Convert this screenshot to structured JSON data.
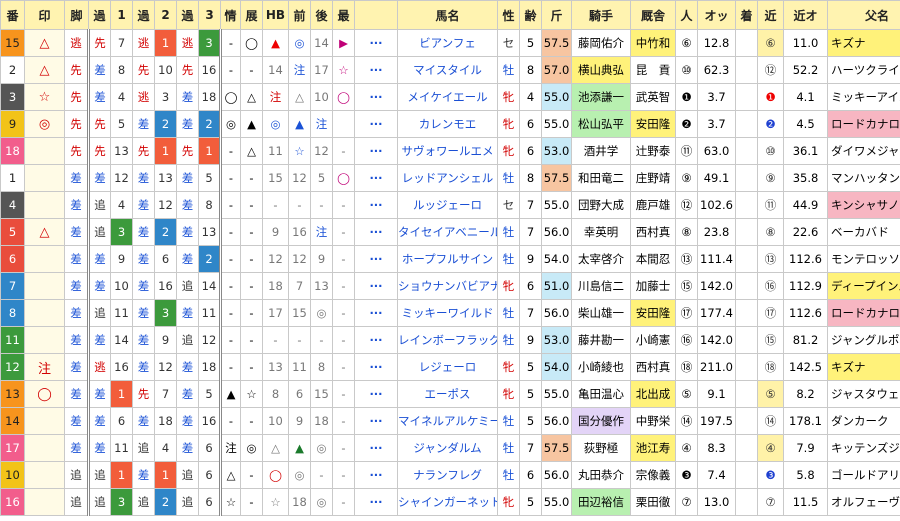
{
  "headers": [
    "番",
    "印",
    "脚",
    "過",
    "1",
    "過",
    "2",
    "過",
    "3",
    "情",
    "展",
    "HB",
    "前",
    "後",
    "最",
    "",
    "馬名",
    "性",
    "齢",
    "斤",
    "騎手",
    "厩舎",
    "人",
    "オッ",
    "着",
    "近",
    "近オ",
    "父名"
  ],
  "rows": [
    {
      "num": "15",
      "num_bg": "#f7941d",
      "mark": "△",
      "mark_c": "#d20000",
      "kyaku": "逃",
      "kyaku_c": "#d20000",
      "p1": "先",
      "p1c": "#d20000",
      "r1": "7",
      "r1bg": "",
      "p2": "逃",
      "p2c": "#d20000",
      "r2": "1",
      "r2bg": "#f25d3b",
      "p3": "逃",
      "p3c": "#d20000",
      "r3": "3",
      "r3bg": "#3c9a3c",
      "jo": "-",
      "ten": "◯",
      "hb": "▲",
      "hbc": "#e00",
      "mae": "◎",
      "maec": "#1b52d6",
      "ato": "14",
      "atoc": "#777",
      "sai": "▶",
      "saic": "#c00077",
      "name": "ビアンフェ",
      "sex": "セ",
      "sexc": "#333",
      "age": "5",
      "kin": "57.5",
      "kinbg": "#f7c5a1",
      "jockey": "藤岡佑介",
      "jbg": "",
      "trainer": "中竹和",
      "tbg": "#fff27a",
      "ninki": "⑥",
      "odds": "12.8",
      "chaku": "",
      "kin2": "⑥",
      "kin2bg": "#fff2a8",
      "kin2c": "#333",
      "kodds": "11.0",
      "sire": "キズナ",
      "sirebg": "#fff27a"
    },
    {
      "num": "2",
      "num_bg": "#ffffff",
      "mark": "△",
      "mark_c": "#d20000",
      "kyaku": "先",
      "kyaku_c": "#d20000",
      "p1": "差",
      "p1c": "#1b52d6",
      "r1": "8",
      "r1bg": "",
      "p2": "先",
      "p2c": "#d20000",
      "r2": "10",
      "r2bg": "",
      "p3": "先",
      "p3c": "#d20000",
      "r3": "16",
      "r3bg": "",
      "jo": "-",
      "ten": "-",
      "hb": "14",
      "hbc": "#777",
      "mae": "注",
      "maec": "#1b52d6",
      "ato": "17",
      "atoc": "#777",
      "sai": "☆",
      "saic": "#c00077",
      "name": "マイスタイル",
      "sex": "牡",
      "sexc": "#1b52d6",
      "age": "8",
      "kin": "57.0",
      "kinbg": "#f7c5a1",
      "jockey": "横山典弘",
      "jbg": "#fff27a",
      "trainer": "昆　貢",
      "tbg": "",
      "ninki": "⑩",
      "odds": "62.3",
      "chaku": "",
      "kin2": "⑫",
      "kin2bg": "",
      "kin2c": "#333",
      "kodds": "52.2",
      "sire": "ハーツクライ",
      "sirebg": ""
    },
    {
      "num": "3",
      "num_bg": "#555555",
      "mark": "☆",
      "mark_c": "#d20000",
      "kyaku": "先",
      "kyaku_c": "#d20000",
      "p1": "差",
      "p1c": "#1b52d6",
      "r1": "4",
      "r1bg": "",
      "p2": "逃",
      "p2c": "#d20000",
      "r2": "3",
      "r2bg": "",
      "p3": "差",
      "p3c": "#1b52d6",
      "r3": "18",
      "r3bg": "",
      "jo": "◯",
      "ten": "△",
      "hb": "注",
      "hbc": "#d20000",
      "mae": "△",
      "maec": "#777",
      "ato": "10",
      "atoc": "#777",
      "sai": "◯",
      "saic": "#c00077",
      "name": "メイケイエール",
      "sex": "牝",
      "sexc": "#d20000",
      "age": "4",
      "kin": "55.0",
      "kinbg": "#c8eaf7",
      "jockey": "池添謙一",
      "jbg": "#b8f0b0",
      "trainer": "武英智",
      "tbg": "",
      "ninki": "❶",
      "odds": "3.7",
      "chaku": "",
      "kin2": "❶",
      "kin2bg": "",
      "kin2c": "#e00",
      "kodds": "4.1",
      "sire": "ミッキーアイル",
      "sirebg": ""
    },
    {
      "num": "9",
      "num_bg": "#f2c318",
      "mark": "◎",
      "mark_c": "#d20000",
      "kyaku": "先",
      "kyaku_c": "#d20000",
      "p1": "先",
      "p1c": "#d20000",
      "r1": "5",
      "r1bg": "",
      "p2": "差",
      "p2c": "#1b52d6",
      "r2": "2",
      "r2bg": "#2f86c8",
      "p3": "差",
      "p3c": "#1b52d6",
      "r3": "2",
      "r3bg": "#2f86c8",
      "jo": "◎",
      "ten": "▲",
      "hb": "◎",
      "hbc": "#1b52d6",
      "mae": "▲",
      "maec": "#1b52d6",
      "ato": "注",
      "atoc": "#1b52d6",
      "sai": "",
      "saic": "#c00077",
      "name": "カレンモエ",
      "sex": "牝",
      "sexc": "#d20000",
      "age": "6",
      "kin": "55.0",
      "kinbg": "",
      "jockey": "松山弘平",
      "jbg": "#b8f0b0",
      "trainer": "安田隆",
      "tbg": "#fff27a",
      "ninki": "❷",
      "odds": "3.7",
      "chaku": "",
      "kin2": "❷",
      "kin2bg": "",
      "kin2c": "#1d3fd0",
      "kodds": "4.5",
      "sire": "ロードカナロア",
      "sirebg": "#f7b6c2"
    },
    {
      "num": "18",
      "num_bg": "#f25d8c",
      "mark": "",
      "mark_c": "#d20000",
      "kyaku": "先",
      "kyaku_c": "#d20000",
      "p1": "先",
      "p1c": "#d20000",
      "r1": "13",
      "r1bg": "",
      "p2": "先",
      "p2c": "#d20000",
      "r2": "1",
      "r2bg": "#f25d3b",
      "p3": "先",
      "p3c": "#d20000",
      "r3": "1",
      "r3bg": "#f25d3b",
      "jo": "-",
      "ten": "△",
      "hb": "11",
      "hbc": "#777",
      "mae": "☆",
      "maec": "#1b52d6",
      "ato": "12",
      "atoc": "#777",
      "sai": "-",
      "saic": "#777",
      "name": "サヴォワールエメ",
      "sex": "牝",
      "sexc": "#d20000",
      "age": "6",
      "kin": "53.0",
      "kinbg": "#c8eaf7",
      "jockey": "酒井学",
      "jbg": "",
      "trainer": "辻野泰",
      "tbg": "",
      "ninki": "⑪",
      "odds": "63.0",
      "chaku": "",
      "kin2": "⑩",
      "kin2bg": "",
      "kin2c": "#333",
      "kodds": "36.1",
      "sire": "ダイワメジャー",
      "sirebg": ""
    },
    {
      "num": "1",
      "num_bg": "#ffffff",
      "mark": "",
      "mark_c": "#d20000",
      "kyaku": "差",
      "kyaku_c": "#1b52d6",
      "p1": "差",
      "p1c": "#1b52d6",
      "r1": "12",
      "r1bg": "",
      "p2": "差",
      "p2c": "#1b52d6",
      "r2": "13",
      "r2bg": "",
      "p3": "差",
      "p3c": "#1b52d6",
      "r3": "5",
      "r3bg": "",
      "jo": "-",
      "ten": "-",
      "hb": "15",
      "hbc": "#777",
      "mae": "12",
      "maec": "#777",
      "ato": "5",
      "atoc": "#777",
      "sai": "◯",
      "saic": "#c00077",
      "name": "レッドアンシェル",
      "sex": "牡",
      "sexc": "#1b52d6",
      "age": "8",
      "kin": "57.5",
      "kinbg": "#f7c5a1",
      "jockey": "和田竜二",
      "jbg": "",
      "trainer": "庄野靖",
      "tbg": "",
      "ninki": "⑨",
      "odds": "49.1",
      "chaku": "",
      "kin2": "⑨",
      "kin2bg": "",
      "kin2c": "#333",
      "kodds": "35.8",
      "sire": "マンハッタンカフェ",
      "sirebg": ""
    },
    {
      "num": "4",
      "num_bg": "#555555",
      "mark": "",
      "mark_c": "#d20000",
      "kyaku": "差",
      "kyaku_c": "#1b52d6",
      "p1": "追",
      "p1c": "#333",
      "r1": "4",
      "r1bg": "",
      "p2": "差",
      "p2c": "#1b52d6",
      "r2": "12",
      "r2bg": "",
      "p3": "差",
      "p3c": "#1b52d6",
      "r3": "8",
      "r3bg": "",
      "jo": "-",
      "ten": "-",
      "hb": "-",
      "hbc": "#777",
      "mae": "-",
      "maec": "#777",
      "ato": "-",
      "atoc": "#777",
      "sai": "-",
      "saic": "#777",
      "name": "ルッジェーロ",
      "sex": "セ",
      "sexc": "#333",
      "age": "7",
      "kin": "55.0",
      "kinbg": "",
      "jockey": "団野大成",
      "jbg": "",
      "trainer": "鹿戸雄",
      "tbg": "",
      "ninki": "⑫",
      "odds": "102.6",
      "chaku": "",
      "kin2": "⑪",
      "kin2bg": "",
      "kin2c": "#333",
      "kodds": "44.9",
      "sire": "キンシャサノキセキ",
      "sirebg": "#f7b6c2"
    },
    {
      "num": "5",
      "num_bg": "#e94d3c",
      "mark": "△",
      "mark_c": "#d20000",
      "kyaku": "差",
      "kyaku_c": "#1b52d6",
      "p1": "追",
      "p1c": "#333",
      "r1": "3",
      "r1bg": "#3c9a3c",
      "p2": "差",
      "p2c": "#1b52d6",
      "r2": "2",
      "r2bg": "#2f86c8",
      "p3": "差",
      "p3c": "#1b52d6",
      "r3": "13",
      "r3bg": "",
      "jo": "-",
      "ten": "-",
      "hb": "9",
      "hbc": "#777",
      "mae": "16",
      "maec": "#777",
      "ato": "注",
      "atoc": "#1b52d6",
      "sai": "-",
      "saic": "#777",
      "name": "タイセイアベニール",
      "sex": "牡",
      "sexc": "#1b52d6",
      "age": "7",
      "kin": "56.0",
      "kinbg": "",
      "jockey": "幸英明",
      "jbg": "",
      "trainer": "西村真",
      "tbg": "",
      "ninki": "⑧",
      "odds": "23.8",
      "chaku": "",
      "kin2": "⑧",
      "kin2bg": "",
      "kin2c": "#333",
      "kodds": "22.6",
      "sire": "ベーカバド",
      "sirebg": ""
    },
    {
      "num": "6",
      "num_bg": "#e94d3c",
      "mark": "",
      "mark_c": "#d20000",
      "kyaku": "差",
      "kyaku_c": "#1b52d6",
      "p1": "差",
      "p1c": "#1b52d6",
      "r1": "9",
      "r1bg": "",
      "p2": "差",
      "p2c": "#1b52d6",
      "r2": "6",
      "r2bg": "",
      "p3": "差",
      "p3c": "#1b52d6",
      "r3": "2",
      "r3bg": "#2f86c8",
      "jo": "-",
      "ten": "-",
      "hb": "12",
      "hbc": "#777",
      "mae": "12",
      "maec": "#777",
      "ato": "9",
      "atoc": "#777",
      "sai": "-",
      "saic": "#777",
      "name": "ホープフルサイン",
      "sex": "牡",
      "sexc": "#1b52d6",
      "age": "9",
      "kin": "54.0",
      "kinbg": "",
      "jockey": "太宰啓介",
      "jbg": "",
      "trainer": "本間忍",
      "tbg": "",
      "ninki": "⑬",
      "odds": "111.4",
      "chaku": "",
      "kin2": "⑬",
      "kin2bg": "",
      "kin2c": "#333",
      "kodds": "112.6",
      "sire": "モンテロッソ",
      "sirebg": ""
    },
    {
      "num": "7",
      "num_bg": "#2f86c8",
      "mark": "",
      "mark_c": "#d20000",
      "kyaku": "差",
      "kyaku_c": "#1b52d6",
      "p1": "差",
      "p1c": "#1b52d6",
      "r1": "10",
      "r1bg": "",
      "p2": "差",
      "p2c": "#1b52d6",
      "r2": "16",
      "r2bg": "",
      "p3": "追",
      "p3c": "#333",
      "r3": "14",
      "r3bg": "",
      "jo": "-",
      "ten": "-",
      "hb": "18",
      "hbc": "#777",
      "mae": "7",
      "maec": "#777",
      "ato": "13",
      "atoc": "#777",
      "sai": "-",
      "saic": "#777",
      "name": "ショウナンバビアナ",
      "sex": "牝",
      "sexc": "#d20000",
      "age": "6",
      "kin": "51.0",
      "kinbg": "#c8eaf7",
      "jockey": "川島信二",
      "jbg": "",
      "trainer": "加藤士",
      "tbg": "",
      "ninki": "⑮",
      "odds": "142.0",
      "chaku": "",
      "kin2": "⑯",
      "kin2bg": "",
      "kin2c": "#333",
      "kodds": "112.9",
      "sire": "ディープインパクト",
      "sirebg": "#fff27a"
    },
    {
      "num": "8",
      "num_bg": "#2f86c8",
      "mark": "",
      "mark_c": "#d20000",
      "kyaku": "差",
      "kyaku_c": "#1b52d6",
      "p1": "追",
      "p1c": "#333",
      "r1": "11",
      "r1bg": "",
      "p2": "差",
      "p2c": "#1b52d6",
      "r2": "3",
      "r2bg": "#3c9a3c",
      "p3": "差",
      "p3c": "#1b52d6",
      "r3": "11",
      "r3bg": "",
      "jo": "-",
      "ten": "-",
      "hb": "17",
      "hbc": "#777",
      "mae": "15",
      "maec": "#777",
      "ato": "◎",
      "atoc": "#777",
      "sai": "-",
      "saic": "#777",
      "name": "ミッキーワイルド",
      "sex": "牡",
      "sexc": "#1b52d6",
      "age": "7",
      "kin": "56.0",
      "kinbg": "",
      "jockey": "柴山雄一",
      "jbg": "",
      "trainer": "安田隆",
      "tbg": "#fff27a",
      "ninki": "⑰",
      "odds": "177.4",
      "chaku": "",
      "kin2": "⑰",
      "kin2bg": "",
      "kin2c": "#333",
      "kodds": "112.6",
      "sire": "ロードカナロア",
      "sirebg": "#f7b6c2"
    },
    {
      "num": "11",
      "num_bg": "#3c9a3c",
      "mark": "",
      "mark_c": "#d20000",
      "kyaku": "差",
      "kyaku_c": "#1b52d6",
      "p1": "差",
      "p1c": "#1b52d6",
      "r1": "14",
      "r1bg": "",
      "p2": "差",
      "p2c": "#1b52d6",
      "r2": "9",
      "r2bg": "",
      "p3": "追",
      "p3c": "#333",
      "r3": "12",
      "r3bg": "",
      "jo": "-",
      "ten": "-",
      "hb": "-",
      "hbc": "#777",
      "mae": "-",
      "maec": "#777",
      "ato": "-",
      "atoc": "#777",
      "sai": "-",
      "saic": "#777",
      "name": "レインボーフラッグ",
      "sex": "牡",
      "sexc": "#1b52d6",
      "age": "9",
      "kin": "53.0",
      "kinbg": "#c8eaf7",
      "jockey": "藤井勘一",
      "jbg": "",
      "trainer": "小崎憲",
      "tbg": "",
      "ninki": "⑯",
      "odds": "142.0",
      "chaku": "",
      "kin2": "⑮",
      "kin2bg": "",
      "kin2c": "#333",
      "kodds": "81.2",
      "sire": "ジャングルポケット",
      "sirebg": ""
    },
    {
      "num": "12",
      "num_bg": "#3c9a3c",
      "mark": "注",
      "mark_c": "#d20000",
      "kyaku": "差",
      "kyaku_c": "#1b52d6",
      "p1": "逃",
      "p1c": "#d20000",
      "r1": "16",
      "r1bg": "",
      "p2": "差",
      "p2c": "#1b52d6",
      "r2": "12",
      "r2bg": "",
      "p3": "差",
      "p3c": "#1b52d6",
      "r3": "18",
      "r3bg": "",
      "jo": "-",
      "ten": "-",
      "hb": "13",
      "hbc": "#777",
      "mae": "11",
      "maec": "#777",
      "ato": "8",
      "atoc": "#777",
      "sai": "-",
      "saic": "#777",
      "name": "レジェーロ",
      "sex": "牝",
      "sexc": "#d20000",
      "age": "5",
      "kin": "54.0",
      "kinbg": "#c8eaf7",
      "jockey": "小崎綾也",
      "jbg": "",
      "trainer": "西村真",
      "tbg": "",
      "ninki": "⑱",
      "odds": "211.0",
      "chaku": "",
      "kin2": "⑱",
      "kin2bg": "",
      "kin2c": "#333",
      "kodds": "142.5",
      "sire": "キズナ",
      "sirebg": "#fff27a"
    },
    {
      "num": "13",
      "num_bg": "#f7941d",
      "mark": "◯",
      "mark_c": "#d20000",
      "kyaku": "差",
      "kyaku_c": "#1b52d6",
      "p1": "差",
      "p1c": "#1b52d6",
      "r1": "1",
      "r1bg": "#f25d3b",
      "p2": "先",
      "p2c": "#d20000",
      "r2": "7",
      "r2bg": "",
      "p3": "差",
      "p3c": "#1b52d6",
      "r3": "5",
      "r3bg": "",
      "jo": "▲",
      "ten": "☆",
      "hb": "8",
      "hbc": "#777",
      "mae": "6",
      "maec": "#777",
      "ato": "15",
      "atoc": "#777",
      "sai": "-",
      "saic": "#777",
      "name": "エーポス",
      "sex": "牝",
      "sexc": "#d20000",
      "age": "5",
      "kin": "55.0",
      "kinbg": "",
      "jockey": "亀田温心",
      "jbg": "",
      "trainer": "北出成",
      "tbg": "#fff27a",
      "ninki": "⑤",
      "odds": "9.1",
      "chaku": "",
      "kin2": "⑤",
      "kin2bg": "#fff2a8",
      "kin2c": "#333",
      "kodds": "8.2",
      "sire": "ジャスタウェイ",
      "sirebg": ""
    },
    {
      "num": "14",
      "num_bg": "#f7941d",
      "mark": "",
      "mark_c": "#d20000",
      "kyaku": "差",
      "kyaku_c": "#1b52d6",
      "p1": "差",
      "p1c": "#1b52d6",
      "r1": "6",
      "r1bg": "",
      "p2": "差",
      "p2c": "#1b52d6",
      "r2": "18",
      "r2bg": "",
      "p3": "差",
      "p3c": "#1b52d6",
      "r3": "16",
      "r3bg": "",
      "jo": "-",
      "ten": "-",
      "hb": "10",
      "hbc": "#777",
      "mae": "9",
      "maec": "#777",
      "ato": "18",
      "atoc": "#777",
      "sai": "-",
      "saic": "#777",
      "name": "マイネルアルケミー",
      "sex": "牡",
      "sexc": "#1b52d6",
      "age": "5",
      "kin": "56.0",
      "kinbg": "",
      "jockey": "国分優作",
      "jbg": "#e3d4f7",
      "trainer": "中野栄",
      "tbg": "",
      "ninki": "⑭",
      "odds": "197.5",
      "chaku": "",
      "kin2": "⑭",
      "kin2bg": "",
      "kin2c": "#333",
      "kodds": "178.1",
      "sire": "ダンカーク",
      "sirebg": ""
    },
    {
      "num": "17",
      "num_bg": "#f25d8c",
      "mark": "",
      "mark_c": "#d20000",
      "kyaku": "差",
      "kyaku_c": "#1b52d6",
      "p1": "差",
      "p1c": "#1b52d6",
      "r1": "11",
      "r1bg": "",
      "p2": "追",
      "p2c": "#333",
      "r2": "4",
      "r2bg": "",
      "p3": "差",
      "p3c": "#1b52d6",
      "r3": "6",
      "r3bg": "",
      "jo": "注",
      "ten": "◎",
      "hb": "△",
      "hbc": "#777",
      "mae": "▲",
      "maec": "#1b7a2c",
      "ato": "◎",
      "atoc": "#777",
      "sai": "-",
      "saic": "#777",
      "name": "ジャンダルム",
      "sex": "牡",
      "sexc": "#1b52d6",
      "age": "7",
      "kin": "57.5",
      "kinbg": "#f7c5a1",
      "jockey": "荻野極",
      "jbg": "",
      "trainer": "池江寿",
      "tbg": "#fff27a",
      "ninki": "④",
      "odds": "8.3",
      "chaku": "",
      "kin2": "④",
      "kin2bg": "#fff2a8",
      "kin2c": "#333",
      "kodds": "7.9",
      "sire": "キッテンズジョイ",
      "sirebg": ""
    },
    {
      "num": "10",
      "num_bg": "#f2c318",
      "mark": "",
      "mark_c": "#d20000",
      "kyaku": "追",
      "kyaku_c": "#333",
      "p1": "追",
      "p1c": "#333",
      "r1": "1",
      "r1bg": "#f25d3b",
      "p2": "差",
      "p2c": "#1b52d6",
      "r2": "1",
      "r2bg": "#f25d3b",
      "p3": "追",
      "p3c": "#333",
      "r3": "6",
      "r3bg": "",
      "jo": "△",
      "ten": "-",
      "hb": "◯",
      "hbc": "#d20000",
      "mae": "◎",
      "maec": "#777",
      "ato": "-",
      "atoc": "#777",
      "sai": "-",
      "saic": "#777",
      "name": "ナランフレグ",
      "sex": "牡",
      "sexc": "#1b52d6",
      "age": "6",
      "kin": "56.0",
      "kinbg": "",
      "jockey": "丸田恭介",
      "jbg": "",
      "trainer": "宗像義",
      "tbg": "",
      "ninki": "❸",
      "odds": "7.4",
      "chaku": "",
      "kin2": "❸",
      "kin2bg": "",
      "kin2c": "#1d3fd0",
      "kodds": "5.8",
      "sire": "ゴールドアリュール",
      "sirebg": ""
    },
    {
      "num": "16",
      "num_bg": "#f25d8c",
      "mark": "",
      "mark_c": "#d20000",
      "kyaku": "追",
      "kyaku_c": "#333",
      "p1": "追",
      "p1c": "#333",
      "r1": "3",
      "r1bg": "#3c9a3c",
      "p2": "追",
      "p2c": "#333",
      "r2": "2",
      "r2bg": "#2f86c8",
      "p3": "追",
      "p3c": "#333",
      "r3": "6",
      "r3bg": "",
      "jo": "☆",
      "ten": "-",
      "hb": "☆",
      "hbc": "#777",
      "mae": "18",
      "maec": "#777",
      "ato": "◎",
      "atoc": "#777",
      "sai": "-",
      "saic": "#777",
      "name": "シャインガーネット",
      "sex": "牝",
      "sexc": "#d20000",
      "age": "5",
      "kin": "55.0",
      "kinbg": "",
      "jockey": "田辺裕信",
      "jbg": "#b8f0b0",
      "trainer": "栗田徹",
      "tbg": "",
      "ninki": "⑦",
      "odds": "13.0",
      "chaku": "",
      "kin2": "⑦",
      "kin2bg": "",
      "kin2c": "#333",
      "kodds": "11.5",
      "sire": "オルフェーヴル",
      "sirebg": ""
    }
  ]
}
